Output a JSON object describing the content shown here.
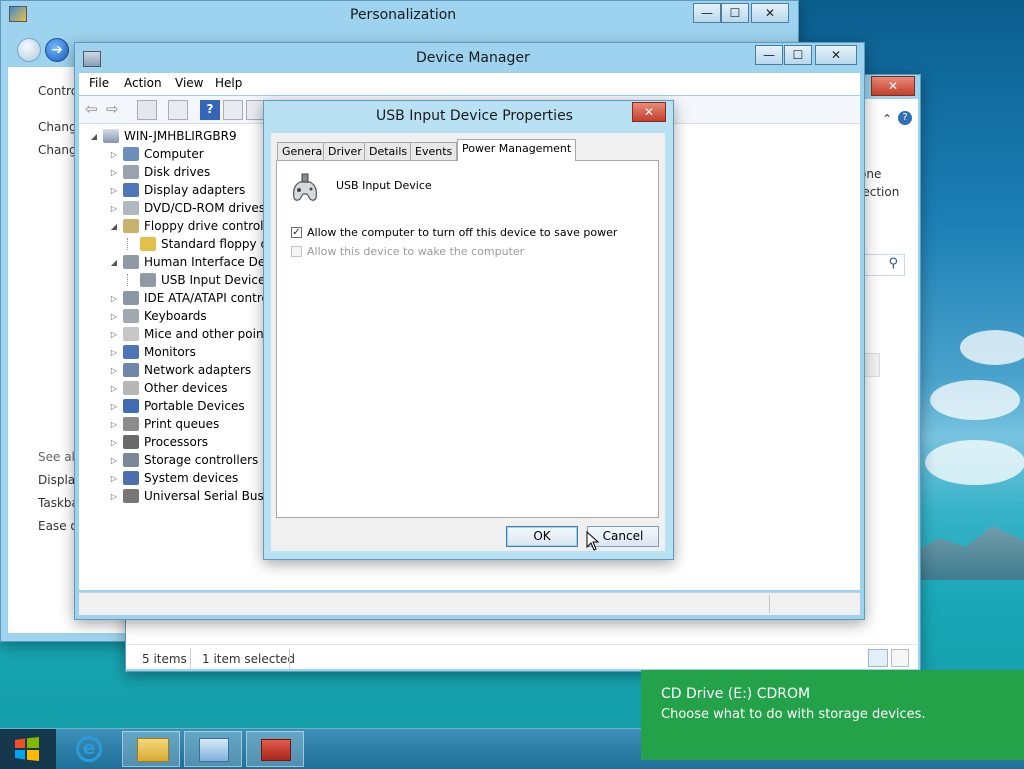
{
  "personalization": {
    "title": "Personalization",
    "left_links": [
      "Contro",
      "Chang",
      "Chang"
    ],
    "see_also": "See als",
    "see_also_links": [
      "Display",
      "Taskba",
      "Ease of"
    ],
    "caption": {
      "minimize": "—",
      "maximize": "☐",
      "close": "✕"
    }
  },
  "back_window": {
    "right_texts": [
      "one",
      "lection"
    ],
    "status": {
      "items": "5 items",
      "selected": "1 item selected"
    },
    "close": "✕"
  },
  "device_manager": {
    "title": "Device Manager",
    "menu": [
      "File",
      "Action",
      "View",
      "Help"
    ],
    "caption": {
      "minimize": "—",
      "maximize": "☐",
      "close": "✕"
    },
    "tree": {
      "root": "WIN-JMHBLIRGBR9",
      "nodes": [
        {
          "label": "Computer",
          "expander": "▷"
        },
        {
          "label": "Disk drives",
          "expander": "▷"
        },
        {
          "label": "Display adapters",
          "expander": "▷"
        },
        {
          "label": "DVD/CD-ROM drives",
          "expander": "▷"
        },
        {
          "label": "Floppy drive controller",
          "expander": "◢"
        },
        {
          "label": "Standard floppy dis",
          "expander": ""
        },
        {
          "label": "Human Interface Devic",
          "expander": "◢"
        },
        {
          "label": "USB Input Device",
          "expander": ""
        },
        {
          "label": "IDE ATA/ATAPI contro",
          "expander": "▷"
        },
        {
          "label": "Keyboards",
          "expander": "▷"
        },
        {
          "label": "Mice and other pointin",
          "expander": "▷"
        },
        {
          "label": "Monitors",
          "expander": "▷"
        },
        {
          "label": "Network adapters",
          "expander": "▷"
        },
        {
          "label": "Other devices",
          "expander": "▷"
        },
        {
          "label": "Portable Devices",
          "expander": "▷"
        },
        {
          "label": "Print queues",
          "expander": "▷"
        },
        {
          "label": "Processors",
          "expander": "▷"
        },
        {
          "label": "Storage controllers",
          "expander": "▷"
        },
        {
          "label": "System devices",
          "expander": "▷"
        },
        {
          "label": "Universal Serial Bus co",
          "expander": "▷"
        }
      ]
    }
  },
  "dialog": {
    "title": "USB Input Device Properties",
    "close": "✕",
    "tabs": [
      "General",
      "Driver",
      "Details",
      "Events",
      "Power Management"
    ],
    "active_tab": "Power Management",
    "device_name": "USB Input Device",
    "options": [
      {
        "label": "Allow the computer to turn off this device to save power",
        "checked": true,
        "enabled": true
      },
      {
        "label": "Allow this device to wake the computer",
        "checked": false,
        "enabled": false
      }
    ],
    "ok": "OK",
    "cancel": "Cancel"
  },
  "toast": {
    "title": "CD Drive (E:) CDROM",
    "message": "Choose what to do with storage devices."
  },
  "colors": {
    "toast": "#23a24a",
    "accent": "#9dd3ee",
    "close": "#c4402b"
  }
}
